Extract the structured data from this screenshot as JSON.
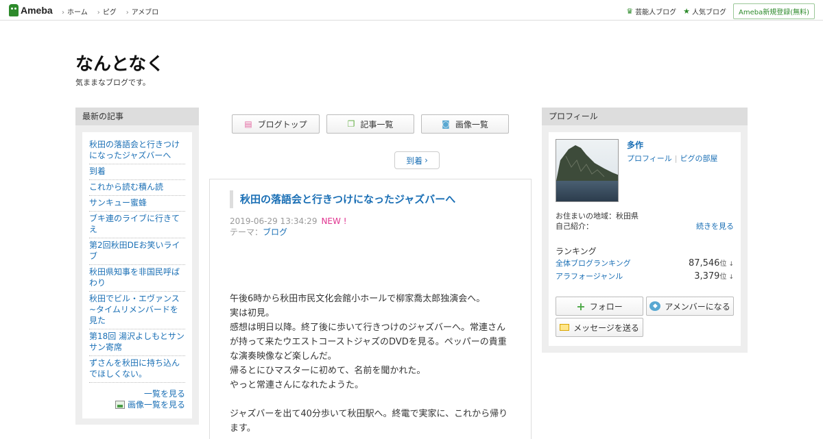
{
  "header": {
    "logo": "Ameba",
    "nav": [
      "ホーム",
      "ピグ",
      "アメブロ"
    ],
    "celebrity_blog": "芸能人ブログ",
    "popular_blog": "人気ブログ",
    "register": "Ameba新規登録(無料)"
  },
  "blog": {
    "title": "なんとなく",
    "description": "気ままなブログです。"
  },
  "sidebar_left": {
    "heading": "最新の記事",
    "items": [
      "秋田の落語会と行きつけになったジャズバーへ",
      "到着",
      "これから読む積ん読",
      "サンキュー蜜蜂",
      "ブキ連のライブに行きてえ",
      "第2回秋田DEお笑いライブ",
      "秋田県知事を非国民呼ばわり",
      "秋田でビル・エヴァンス~タイムリメンバードを見た",
      "第18回 湯沢よしもとサンサン寄席",
      "ずさんを秋田に持ち込んでほしくない。"
    ],
    "list_all": "一覧を見る",
    "image_list": "画像一覧を見る"
  },
  "center": {
    "blog_top": "ブログトップ",
    "article_list": "記事一覧",
    "image_list": "画像一覧",
    "next": "到着"
  },
  "article": {
    "title": "秋田の落語会と行きつけになったジャズバーへ",
    "date": "2019-06-29 13:34:29",
    "new_badge": "NEW !",
    "theme_label": "テーマ：",
    "theme": "ブログ",
    "body": [
      "午後6時から秋田市民文化会館小ホールで柳家喬太郎独演会へ。",
      "実は初見。",
      "感想は明日以降。終了後に歩いて行きつけのジャズバーへ。常連さんが持って来たウエストコーストジャズのDVDを見る。ペッパーの貴重な演奏映像など楽しんだ。",
      "帰るとにひマスターに初めて、名前を聞かれた。",
      "やっと常連さんになれたようた。",
      "",
      "ジャズバーを出て40分歩いて秋田駅へ。終電で実家に、これから帰ります。"
    ]
  },
  "profile": {
    "heading": "プロフィール",
    "name": "多作",
    "profile_link": "プロフィール",
    "pigg_room": "ピグの部屋",
    "residence": "お住まいの地域：秋田県",
    "intro_label": "自己紹介：",
    "read_more": "続きを見る",
    "ranking_label": "ランキング",
    "rankings": [
      {
        "name": "全体ブログランキング",
        "value": "87,546",
        "unit": "位",
        "arrow": "↓"
      },
      {
        "name": "アラフォージャンル",
        "value": "3,379",
        "unit": "位",
        "arrow": "↓"
      }
    ],
    "follow": "フォロー",
    "amember": "アメンバーになる",
    "message": "メッセージを送る"
  }
}
